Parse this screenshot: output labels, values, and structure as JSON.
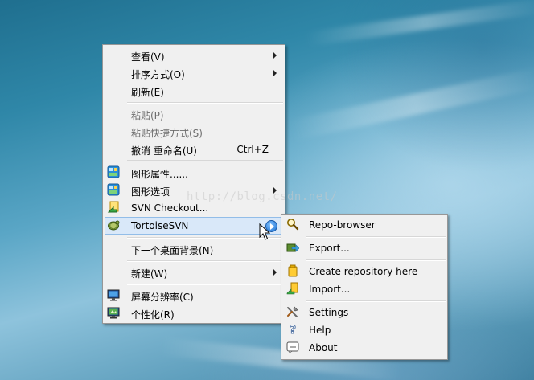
{
  "desktop_menu": {
    "items": [
      {
        "label": "查看(V)"
      },
      {
        "label": "排序方式(O)"
      },
      {
        "label": "刷新(E)"
      },
      {
        "label": "粘贴(P)"
      },
      {
        "label": "粘贴快捷方式(S)"
      },
      {
        "label": "撤消 重命名(U)",
        "shortcut": "Ctrl+Z"
      },
      {
        "label": "图形属性......"
      },
      {
        "label": "图形选项"
      },
      {
        "label": "SVN Checkout..."
      },
      {
        "label": "TortoiseSVN"
      },
      {
        "label": "下一个桌面背景(N)"
      },
      {
        "label": "新建(W)"
      },
      {
        "label": "屏幕分辨率(C)"
      },
      {
        "label": "个性化(R)"
      }
    ]
  },
  "tortoise_submenu": {
    "items": [
      {
        "label": "Repo-browser"
      },
      {
        "label": "Export..."
      },
      {
        "label": "Create repository here"
      },
      {
        "label": "Import..."
      },
      {
        "label": "Settings"
      },
      {
        "label": "Help"
      },
      {
        "label": "About"
      }
    ]
  },
  "watermark": "http://blog.csdn.net/",
  "colors": {
    "menu_bg": "#f0f0f0",
    "highlight_bg": "#d9e8f9",
    "highlight_border": "#92bde8",
    "disabled_text": "#6d6d6d"
  }
}
